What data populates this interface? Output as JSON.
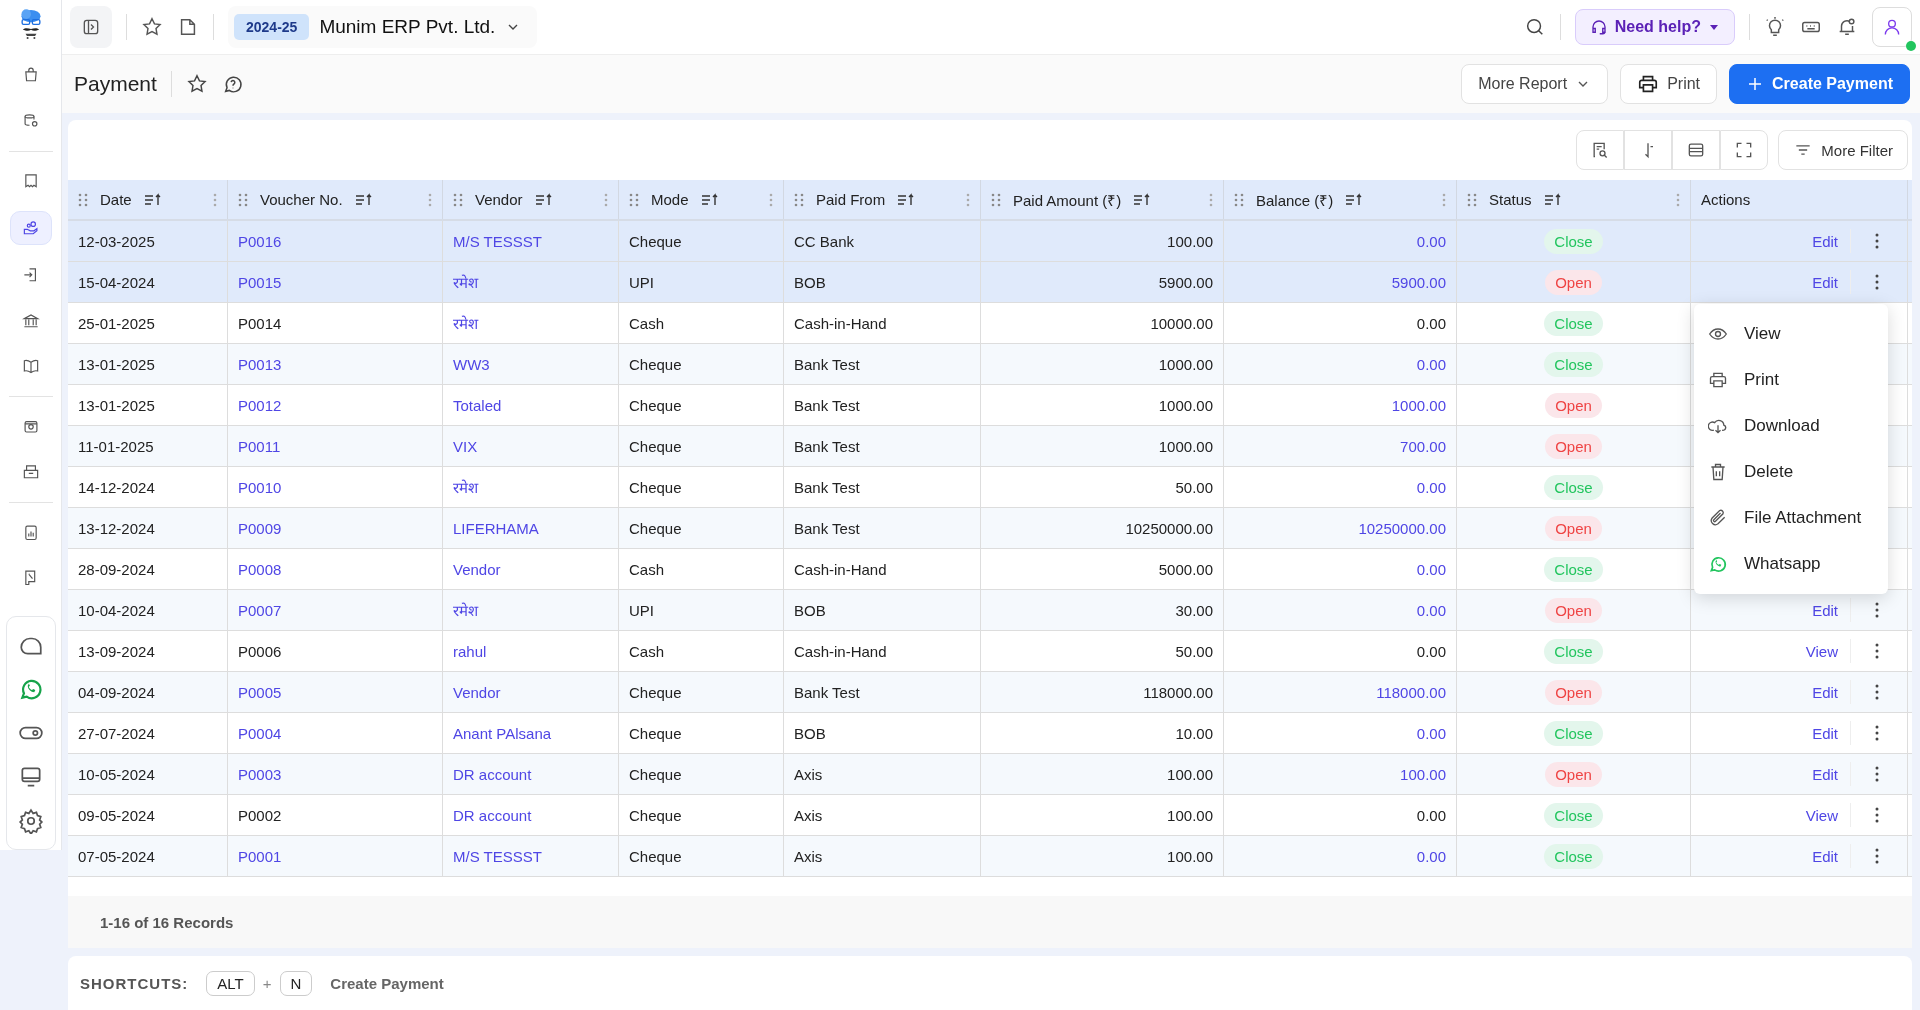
{
  "topbar": {
    "fiscal_year": "2024-25",
    "company": "Munim ERP Pvt. Ltd.",
    "help": "Need help?",
    "online": true
  },
  "page": {
    "title": "Payment",
    "buttons": {
      "more_report": "More Report",
      "print": "Print",
      "create": "Create Payment"
    }
  },
  "sidebar": {
    "items": [
      {
        "selected": false
      },
      {
        "selected": false
      },
      {
        "selected": false
      },
      {
        "selected": true
      },
      {
        "selected": false
      },
      {
        "selected": false
      },
      {
        "selected": false
      },
      {
        "selected": false
      },
      {
        "selected": false
      },
      {
        "selected": false
      },
      {
        "selected": false
      }
    ]
  },
  "toolbar": {
    "more_filter": "More Filter"
  },
  "table": {
    "columns": [
      {
        "label": "Date"
      },
      {
        "label": "Voucher No."
      },
      {
        "label": "Vendor"
      },
      {
        "label": "Mode"
      },
      {
        "label": "Paid From"
      },
      {
        "label": "Paid Amount (₹)"
      },
      {
        "label": "Balance (₹)"
      },
      {
        "label": "Status"
      },
      {
        "label": "Actions"
      }
    ],
    "rows": [
      {
        "date": "12-03-2025",
        "voucher": "P0016",
        "vendor": "M/S TESSST",
        "mode": "Cheque",
        "paid_from": "CC Bank",
        "amount": "100.00",
        "balance": "0.00",
        "status": "Close",
        "open": false,
        "linked": true,
        "selected": true,
        "action": "Edit"
      },
      {
        "date": "15-04-2024",
        "voucher": "P0015",
        "vendor": "रमेश",
        "mode": "UPI",
        "paid_from": "BOB",
        "amount": "5900.00",
        "balance": "5900.00",
        "status": "Open",
        "open": true,
        "linked": true,
        "selected": true,
        "action": "Edit"
      },
      {
        "date": "25-01-2025",
        "voucher": "P0014",
        "vendor": "रमेश",
        "mode": "Cash",
        "paid_from": "Cash-in-Hand",
        "amount": "10000.00",
        "balance": "0.00",
        "status": "Close",
        "open": false,
        "linked": false,
        "selected": false
      },
      {
        "date": "13-01-2025",
        "voucher": "P0013",
        "vendor": "WW3",
        "mode": "Cheque",
        "paid_from": "Bank Test",
        "amount": "1000.00",
        "balance": "0.00",
        "status": "Close",
        "open": false,
        "linked": true,
        "selected": false
      },
      {
        "date": "13-01-2025",
        "voucher": "P0012",
        "vendor": "Totaled",
        "mode": "Cheque",
        "paid_from": "Bank Test",
        "amount": "1000.00",
        "balance": "1000.00",
        "status": "Open",
        "open": true,
        "linked": true,
        "selected": false
      },
      {
        "date": "11-01-2025",
        "voucher": "P0011",
        "vendor": "VIX",
        "mode": "Cheque",
        "paid_from": "Bank Test",
        "amount": "1000.00",
        "balance": "700.00",
        "status": "Open",
        "open": true,
        "linked": true,
        "selected": false
      },
      {
        "date": "14-12-2024",
        "voucher": "P0010",
        "vendor": "रमेश",
        "mode": "Cheque",
        "paid_from": "Bank Test",
        "amount": "50.00",
        "balance": "0.00",
        "status": "Close",
        "open": false,
        "linked": true,
        "selected": false
      },
      {
        "date": "13-12-2024",
        "voucher": "P0009",
        "vendor": "LIFERHAMA",
        "mode": "Cheque",
        "paid_from": "Bank Test",
        "amount": "10250000.00",
        "balance": "10250000.00",
        "status": "Open",
        "open": true,
        "linked": true,
        "selected": false
      },
      {
        "date": "28-09-2024",
        "voucher": "P0008",
        "vendor": "Vendor",
        "mode": "Cash",
        "paid_from": "Cash-in-Hand",
        "amount": "5000.00",
        "balance": "0.00",
        "status": "Close",
        "open": false,
        "linked": true,
        "selected": false
      },
      {
        "date": "10-04-2024",
        "voucher": "P0007",
        "vendor": "रमेश",
        "mode": "UPI",
        "paid_from": "BOB",
        "amount": "30.00",
        "balance": "0.00",
        "status": "Open",
        "open": true,
        "linked": true,
        "selected": false,
        "action": "Edit"
      },
      {
        "date": "13-09-2024",
        "voucher": "P0006",
        "vendor": "rahul",
        "mode": "Cash",
        "paid_from": "Cash-in-Hand",
        "amount": "50.00",
        "balance": "0.00",
        "status": "Close",
        "open": false,
        "linked": false,
        "selected": false,
        "action": "View"
      },
      {
        "date": "04-09-2024",
        "voucher": "P0005",
        "vendor": "Vendor",
        "mode": "Cheque",
        "paid_from": "Bank Test",
        "amount": "118000.00",
        "balance": "118000.00",
        "status": "Open",
        "open": true,
        "linked": true,
        "selected": false,
        "action": "Edit"
      },
      {
        "date": "27-07-2024",
        "voucher": "P0004",
        "vendor": "Anant PAlsana",
        "mode": "Cheque",
        "paid_from": "BOB",
        "amount": "10.00",
        "balance": "0.00",
        "status": "Close",
        "open": false,
        "linked": true,
        "selected": false,
        "action": "Edit"
      },
      {
        "date": "10-05-2024",
        "voucher": "P0003",
        "vendor": "DR account",
        "mode": "Cheque",
        "paid_from": "Axis",
        "amount": "100.00",
        "balance": "100.00",
        "status": "Open",
        "open": true,
        "linked": true,
        "selected": false,
        "action": "Edit"
      },
      {
        "date": "09-05-2024",
        "voucher": "P0002",
        "vendor": "DR account",
        "mode": "Cheque",
        "paid_from": "Axis",
        "amount": "100.00",
        "balance": "0.00",
        "status": "Close",
        "open": false,
        "linked": false,
        "selected": false,
        "action": "View"
      },
      {
        "date": "07-05-2024",
        "voucher": "P0001",
        "vendor": "M/S TESSST",
        "mode": "Cheque",
        "paid_from": "Axis",
        "amount": "100.00",
        "balance": "0.00",
        "status": "Close",
        "open": false,
        "linked": true,
        "selected": false,
        "action": "Edit"
      }
    ]
  },
  "context_menu": {
    "items": [
      {
        "label": "View",
        "kind": "view"
      },
      {
        "label": "Print",
        "kind": "print"
      },
      {
        "label": "Download",
        "kind": "download"
      },
      {
        "label": "Delete",
        "kind": "delete"
      },
      {
        "label": "File Attachment",
        "kind": "attachment"
      },
      {
        "label": "Whatsapp",
        "kind": "whatsapp"
      }
    ]
  },
  "footer": {
    "records": "1-16 of 16 Records"
  },
  "shortcuts": {
    "label": "SHORTCUTS:",
    "keys": [
      "ALT",
      "N"
    ],
    "joiner": "+",
    "action": "Create Payment"
  }
}
